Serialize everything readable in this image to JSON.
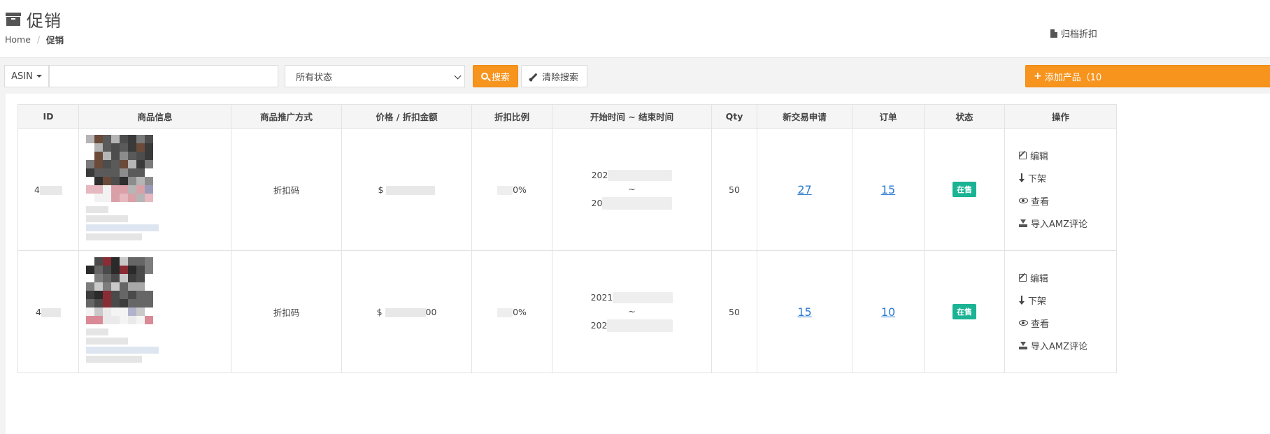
{
  "header": {
    "title": "促销",
    "breadcrumb": {
      "home": "Home",
      "current": "促销"
    },
    "archive_link": "归档折扣"
  },
  "toolbar": {
    "asin_dropdown_label": "ASIN",
    "search_value": "",
    "status_select_value": "所有状态",
    "search_button": "搜索",
    "clear_button": "清除搜索",
    "add_button": "添加产品（10"
  },
  "table": {
    "columns": [
      "ID",
      "商品信息",
      "商品推广方式",
      "价格 / 折扣金额",
      "折扣比例",
      "开始时间 ~ 结束时间",
      "Qty",
      "新交易申请",
      "订单",
      "状态",
      "操作"
    ],
    "rows": [
      {
        "id_prefix": "4",
        "method": "折扣码",
        "price_prefix": "$",
        "price_suffix": "",
        "discount_suffix": "0%",
        "start_prefix": "202",
        "tilde": "~",
        "end_prefix": "20",
        "qty": "50",
        "new_requests": "27",
        "orders": "15",
        "status": "在售"
      },
      {
        "id_prefix": "4",
        "method": "折扣码",
        "price_prefix": "$",
        "price_suffix": "00",
        "discount_suffix": "0%",
        "start_prefix": "2021",
        "tilde": "~",
        "end_prefix": "202",
        "qty": "50",
        "new_requests": "15",
        "orders": "10",
        "status": "在售"
      }
    ],
    "actions": {
      "edit": "编辑",
      "delist": "下架",
      "view": "查看",
      "import": "导入AMZ评论"
    }
  },
  "colors": {
    "accent_orange": "#f7941d",
    "status_green": "#1ab394",
    "link_blue": "#2a7bd1"
  },
  "icons": [
    "archive-icon",
    "file-icon",
    "caret-down-icon",
    "chevron-down-icon",
    "search-icon",
    "brush-icon",
    "plus-icon",
    "edit-icon",
    "arrow-down-icon",
    "eye-icon",
    "import-icon"
  ]
}
